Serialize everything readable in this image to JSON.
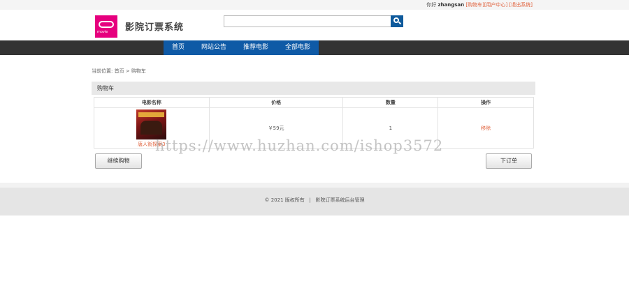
{
  "topbar": {
    "greeting": "你好",
    "username": "zhangsan",
    "links": [
      "[购物车]",
      "[用户中心]",
      "[退出系统]"
    ]
  },
  "header": {
    "logo_text": "movie",
    "site_title": "影院订票系统",
    "search": {
      "value": "",
      "placeholder": ""
    }
  },
  "nav": {
    "items": [
      "首页",
      "网站公告",
      "推荐电影",
      "全部电影"
    ]
  },
  "breadcrumb": {
    "prefix": "当前位置:",
    "home": "首页",
    "separator": ">",
    "current": "购物车"
  },
  "cart": {
    "title": "购物车",
    "columns": [
      "电影名称",
      "价格",
      "数量",
      "操作"
    ],
    "rows": [
      {
        "movie_name": "唐人街探案3",
        "price": "￥59元",
        "quantity": "1",
        "action": "移除"
      }
    ]
  },
  "buttons": {
    "continue_label": "继续购物",
    "order_label": "下订单"
  },
  "footer": {
    "copyright": "© 2021 版权所有",
    "separator": "|",
    "admin_link": "影院订票系统后台管理"
  },
  "watermark": "https://www.huzhan.com/ishop3572",
  "colors": {
    "nav_blue": "#0f5aa6",
    "nav_dark": "#333333",
    "link_orange": "#e0603a",
    "logo_pink": "#e6007e"
  }
}
